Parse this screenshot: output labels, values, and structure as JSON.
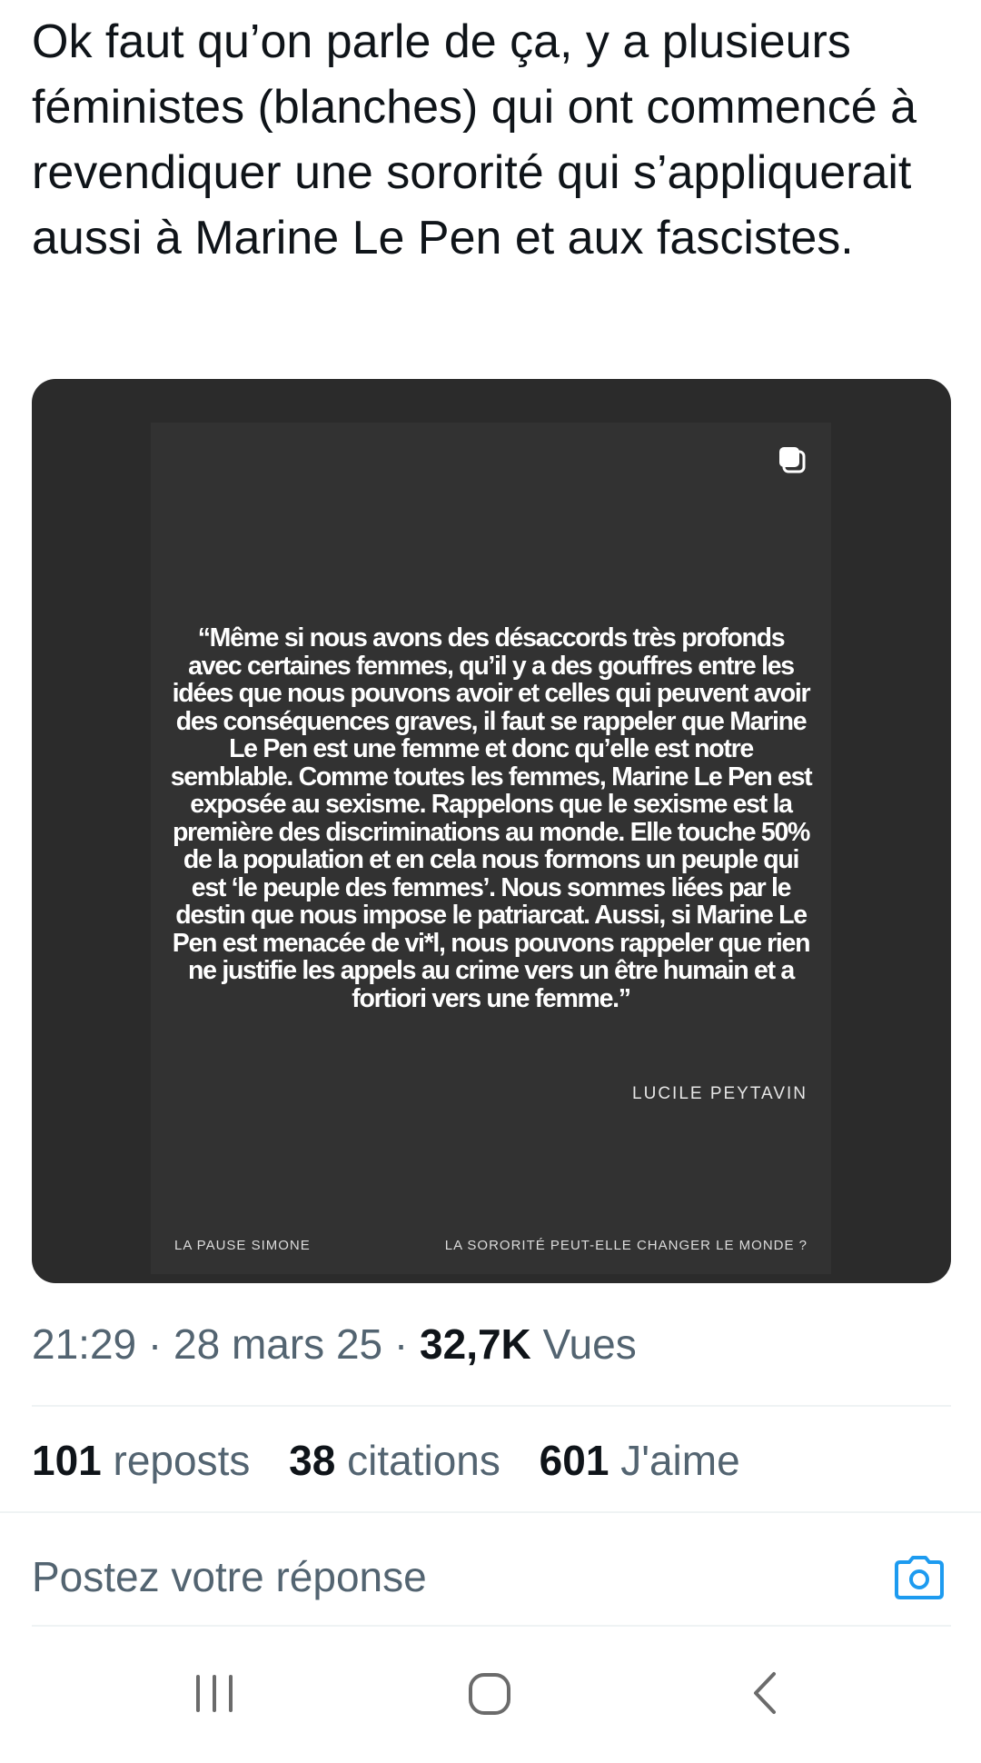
{
  "tweet": {
    "text": "Ok faut qu’on parle de ça, y a plusieurs féministes (blanches) qui ont commencé à revendiquer une sororité qui s’appliquerait aussi à Marine Le Pen et aux fascistes."
  },
  "media": {
    "quote": "“Même si nous avons des désaccords très profonds avec certaines femmes, qu’il y a des gouffres entre les idées que nous pouvons avoir et celles qui peuvent avoir des conséquences graves, il faut se rappeler que Marine Le Pen est une femme et donc qu’elle est notre semblable. Comme toutes les femmes, Marine Le Pen est exposée au sexisme. Rappelons que le sexisme est la première des discriminations au monde. Elle touche 50% de la population et en cela nous formons un peuple qui est ‘le peuple des femmes’. Nous sommes liées par le destin que nous impose le patriarcat. Aussi, si Marine Le Pen est menacée de vi*l, nous pouvons rappeler que rien ne justifie les appels au crime vers un être humain et a fortiori vers une femme.”",
    "author": "LUCILE PEYTAVIN",
    "footer_left": "LA PAUSE SIMONE",
    "footer_right": "LA SORORITÉ PEUT-ELLE CHANGER LE MONDE ?",
    "icon": "multiple-images-icon"
  },
  "meta": {
    "time": "21:29",
    "date": "28 mars 25",
    "separator": "·",
    "views_count": "32,7K",
    "views_label": "Vues"
  },
  "stats": {
    "reposts_count": "101",
    "reposts_label": "reposts",
    "quotes_count": "38",
    "quotes_label": "citations",
    "likes_count": "601",
    "likes_label": "J'aime"
  },
  "reply": {
    "placeholder": "Postez votre réponse",
    "icon": "camera-icon"
  },
  "navbar": {
    "icons": [
      "recent-apps-icon",
      "home-icon",
      "back-icon"
    ]
  },
  "colors": {
    "text_primary": "#0f1419",
    "text_secondary": "#536471",
    "accent": "#1d9bf0",
    "media_bg": "#2b2b2b",
    "divider": "#eff3f4"
  }
}
